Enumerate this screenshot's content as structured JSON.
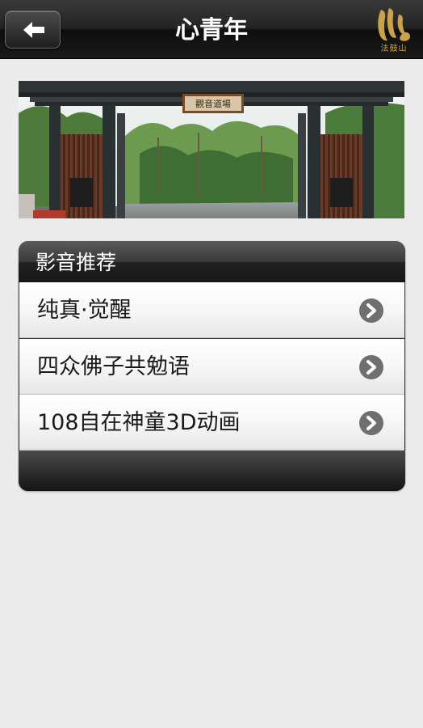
{
  "header": {
    "title": "心青年",
    "back_icon": "back-arrow-icon",
    "logo_icon": "dharma-drum-logo",
    "logo_text": "法鼓山"
  },
  "banner": {
    "image": "temple-gate-photo",
    "sign_text": "觀音道場"
  },
  "section": {
    "title": "影音推荐",
    "items": [
      {
        "label": "纯真·觉醒",
        "icon": "chevron-right-icon"
      },
      {
        "label": "四众佛子共勉语",
        "icon": "chevron-right-icon"
      },
      {
        "label": "108自在神童3D动画",
        "icon": "chevron-right-icon"
      }
    ]
  },
  "colors": {
    "topbar": "#1a1a1a",
    "background": "#ebebeb",
    "logo_gold": "#c9a24a",
    "chevron": "#6f6f6f"
  }
}
